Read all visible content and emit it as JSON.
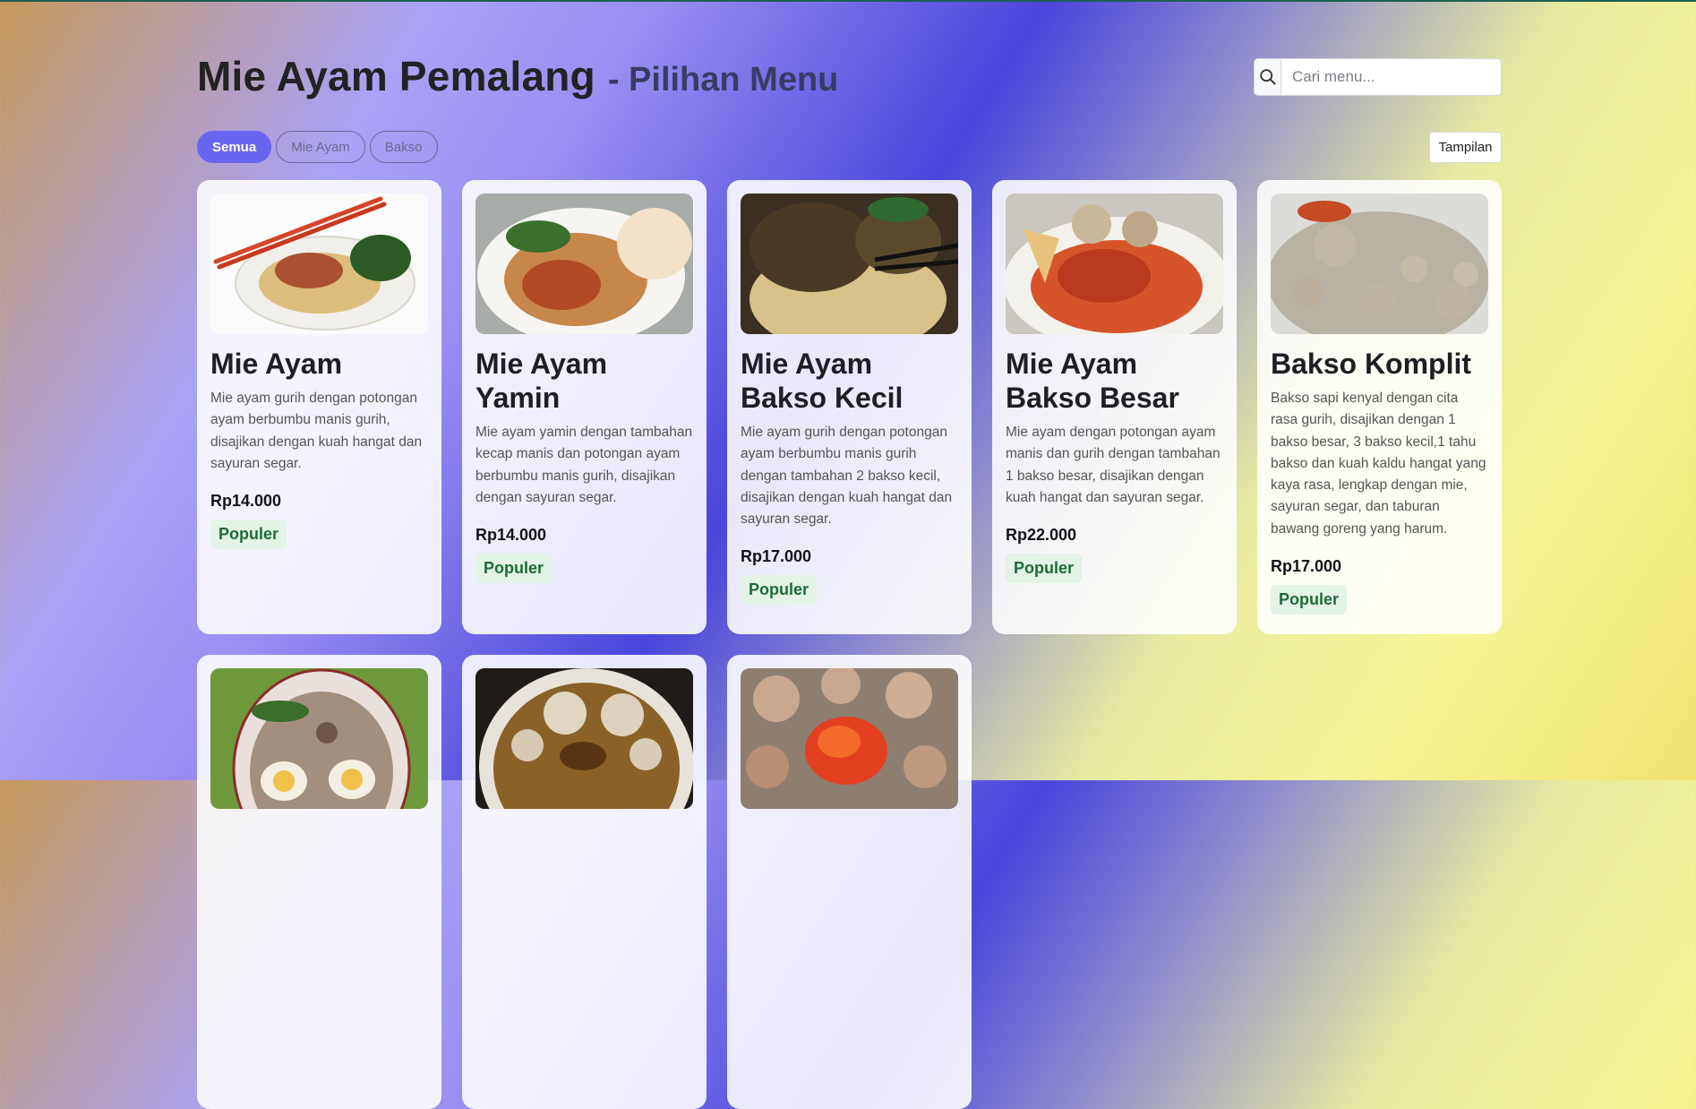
{
  "header": {
    "title": "Mie Ayam Pemalang",
    "subtitle": "- Pilihan Menu"
  },
  "search": {
    "placeholder": "Cari menu...",
    "icon": "search-icon"
  },
  "filters": [
    "Semua",
    "Mie Ayam",
    "Bakso"
  ],
  "view_button": "Tampilan",
  "menu": [
    {
      "title": "Mie Ayam",
      "desc": "Mie ayam gurih dengan potongan ayam berbumbu manis gurih, disajikan dengan kuah hangat dan sayuran segar.",
      "price": "Rp14.000",
      "badge": "Populer"
    },
    {
      "title": "Mie Ayam Yamin",
      "desc": "Mie ayam yamin dengan tambahan kecap manis dan potongan ayam berbumbu manis gurih, disajikan dengan sayuran segar.",
      "price": "Rp14.000",
      "badge": "Populer"
    },
    {
      "title": "Mie Ayam Bakso Kecil",
      "desc": "Mie ayam gurih dengan potongan ayam berbumbu manis gurih dengan tambahan 2 bakso kecil, disajikan dengan kuah hangat dan sayuran segar.",
      "price": "Rp17.000",
      "badge": "Populer"
    },
    {
      "title": "Mie Ayam Bakso Besar",
      "desc": "Mie ayam dengan potongan ayam manis dan gurih dengan tambahan 1 bakso besar, disajikan dengan kuah hangat dan sayuran segar.",
      "price": "Rp22.000",
      "badge": "Populer"
    },
    {
      "title": "Bakso Komplit",
      "desc": "Bakso sapi kenyal dengan cita rasa gurih, disajikan dengan 1 bakso besar, 3 bakso kecil,1 tahu bakso dan kuah kaldu hangat yang kaya rasa, lengkap dengan mie, sayuran segar, dan taburan bawang goreng yang harum.",
      "price": "Rp17.000",
      "badge": "Populer"
    },
    {
      "title": "",
      "desc": "",
      "price": "",
      "badge": ""
    },
    {
      "title": "",
      "desc": "",
      "price": "",
      "badge": ""
    },
    {
      "title": "",
      "desc": "",
      "price": "",
      "badge": ""
    }
  ]
}
